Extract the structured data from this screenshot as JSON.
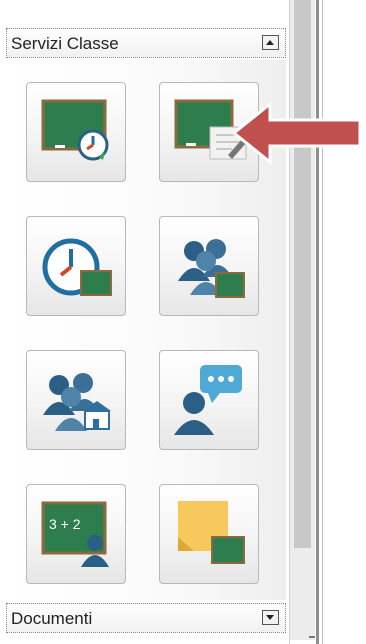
{
  "sections": {
    "servizi": {
      "title": "Servizi Classe",
      "toggle_icon": "collapse-up-icon"
    },
    "documenti": {
      "title": "Documenti",
      "toggle_icon": "expand-down-icon"
    }
  },
  "tiles": [
    {
      "icon": "chalkboard-clock-icon"
    },
    {
      "icon": "chalkboard-note-icon"
    },
    {
      "icon": "clock-chalkboard-icon"
    },
    {
      "icon": "students-chalkboard-icon"
    },
    {
      "icon": "students-school-icon"
    },
    {
      "icon": "person-chat-icon"
    },
    {
      "icon": "chalkboard-math-person-icon"
    },
    {
      "icon": "sticky-note-chalkboard-icon"
    }
  ],
  "colors": {
    "chalkboard_green": "#2e7d4f",
    "chalkboard_frame": "#8b6a3e",
    "icon_blue": "#2c5f86",
    "clock_blue": "#1f6fa3",
    "arrow_red": "#c0504d",
    "note_yellow": "#f7c85b"
  },
  "chalk_math_text": "3 + 2"
}
